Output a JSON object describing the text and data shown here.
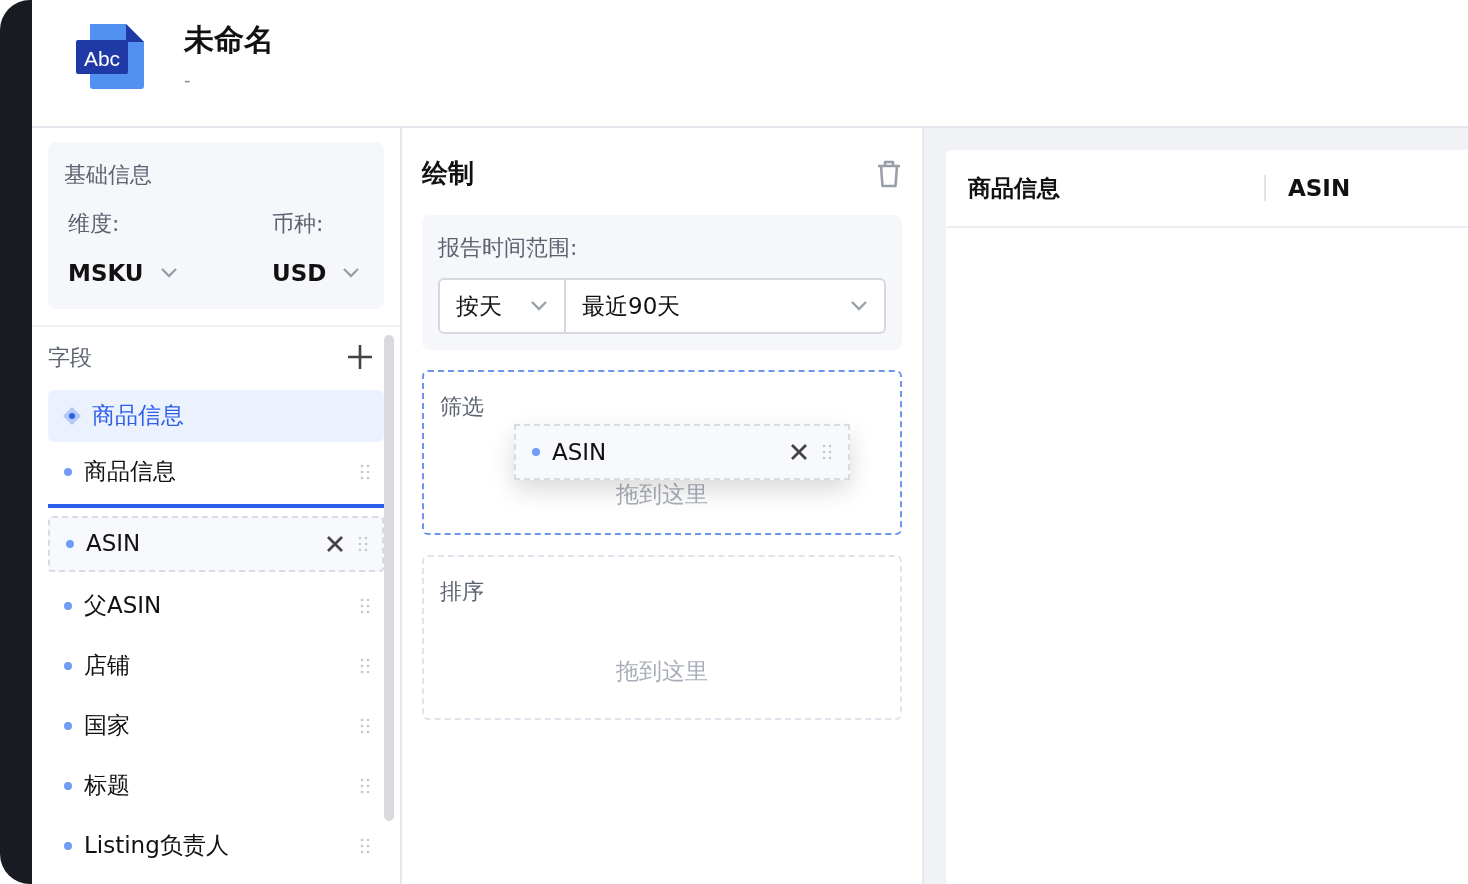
{
  "header": {
    "title": "未命名",
    "subtitle": "-",
    "logo_text": "Abc"
  },
  "basic_info": {
    "title": "基础信息",
    "selectors": [
      {
        "label": "维度:",
        "value": "MSKU"
      },
      {
        "label": "币种:",
        "value": "USD"
      }
    ]
  },
  "fields": {
    "title": "字段",
    "groups": [
      {
        "label": "商品信息",
        "selected": true,
        "items": [
          {
            "label": "商品信息",
            "dragging": false
          },
          {
            "label": "ASIN",
            "dragging": true
          },
          {
            "label": "父ASIN",
            "dragging": false
          },
          {
            "label": "店铺",
            "dragging": false
          },
          {
            "label": "国家",
            "dragging": false
          },
          {
            "label": "标题",
            "dragging": false
          },
          {
            "label": "Listing负责人",
            "dragging": false
          }
        ]
      }
    ]
  },
  "draw": {
    "title": "绘制",
    "time_range": {
      "label": "报告时间范围:",
      "granularity": "按天",
      "range": "最近90天"
    },
    "zones": [
      {
        "title": "筛选",
        "placeholder": "拖到这里",
        "active": true,
        "dragged_item": "ASIN"
      },
      {
        "title": "排序",
        "placeholder": "拖到这里",
        "active": false
      }
    ]
  },
  "table": {
    "columns": [
      "商品信息",
      "ASIN"
    ]
  }
}
